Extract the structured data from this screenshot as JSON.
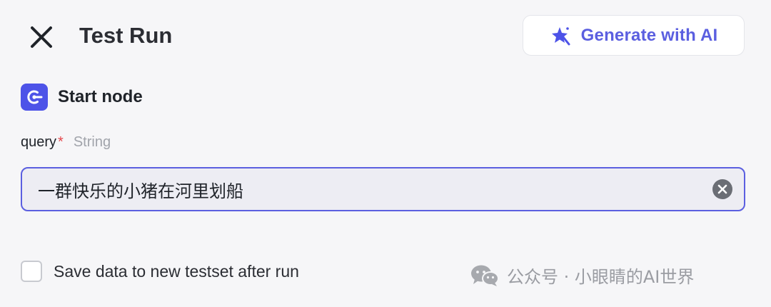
{
  "header": {
    "title": "Test Run",
    "generate_label": "Generate with AI"
  },
  "node": {
    "title": "Start node"
  },
  "field": {
    "name": "query",
    "required_mark": "*",
    "type": "String",
    "value": "一群快乐的小猪在河里划船"
  },
  "footer": {
    "save_label": "Save data to new testset after run",
    "save_checked": false
  },
  "watermark": {
    "text": "公众号 · 小眼睛的AI世界"
  },
  "colors": {
    "accent": "#5b5fe0",
    "node_icon_bg": "#4d53e8",
    "required": "#e5484d",
    "background": "#f6f6f8"
  }
}
